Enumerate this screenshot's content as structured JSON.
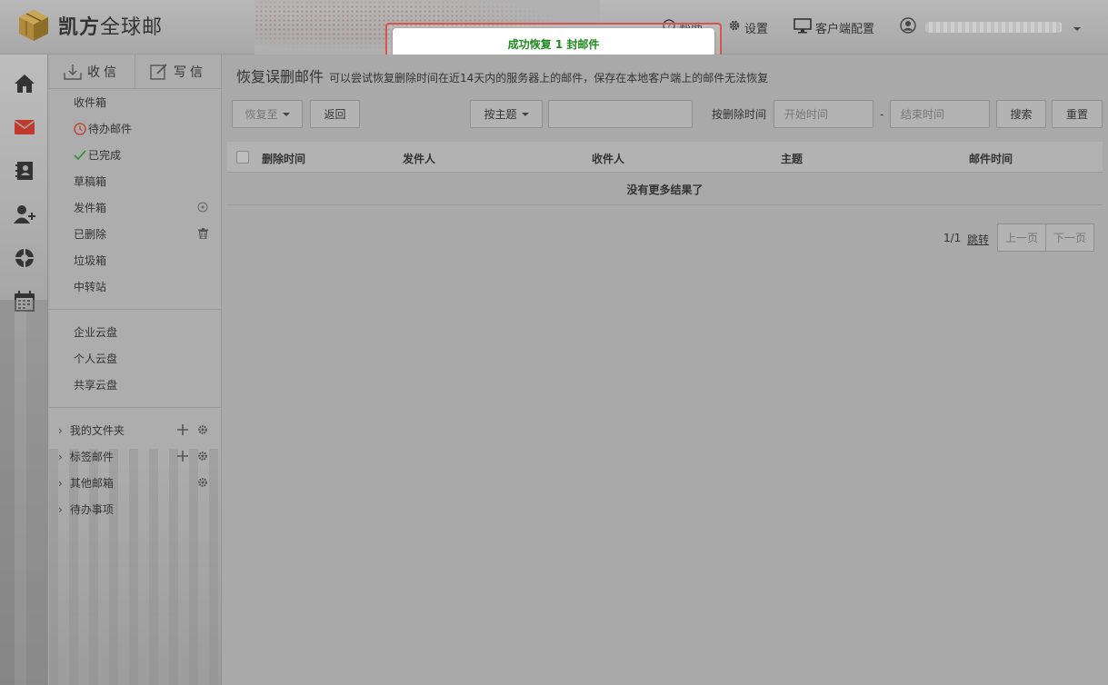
{
  "app": {
    "logo_bold": "凯方",
    "logo_rest": "全球邮",
    "header_hidden_item": "帮助",
    "settings_label": "设置",
    "client_config_label": "客户端配置"
  },
  "toast": {
    "message": "成功恢复 1 封邮件"
  },
  "compose": {
    "inbox_btn": "收信",
    "write_btn": "写信"
  },
  "folders": {
    "inbox": "收件箱",
    "todo": "待办邮件",
    "done": "已完成",
    "drafts": "草稿箱",
    "sent": "发件箱",
    "deleted": "已删除",
    "spam": "垃圾箱",
    "transit": "中转站",
    "ent_cloud": "企业云盘",
    "personal_cloud": "个人云盘",
    "shared_cloud": "共享云盘",
    "my_folders": "我的文件夹",
    "tag_mail": "标签邮件",
    "other_mailbox": "其他邮箱",
    "todo_items": "待办事项"
  },
  "page": {
    "title": "恢复误删邮件",
    "hint": "可以尝试恢复删除时间在近14天内的服务器上的邮件，保存在本地客户端上的邮件无法恢复"
  },
  "toolbar": {
    "restore_to": "恢复至",
    "back": "返回",
    "by_subject": "按主题",
    "search_value": "",
    "by_delete_time": "按删除时间",
    "start_placeholder": "开始时间",
    "dash": "-",
    "end_placeholder": "结束时间",
    "search": "搜索",
    "reset": "重置"
  },
  "table": {
    "columns": [
      "删除时间",
      "发件人",
      "收件人",
      "主题",
      "邮件时间"
    ],
    "empty_text": "没有更多结果了"
  },
  "pager": {
    "info": "1/1",
    "jump": "跳转",
    "prev": "上一页",
    "next": "下一页"
  },
  "colors": {
    "toast_text": "#1e8a1e",
    "toast_border": "#d9534f",
    "mail_icon": "#c0392b"
  }
}
